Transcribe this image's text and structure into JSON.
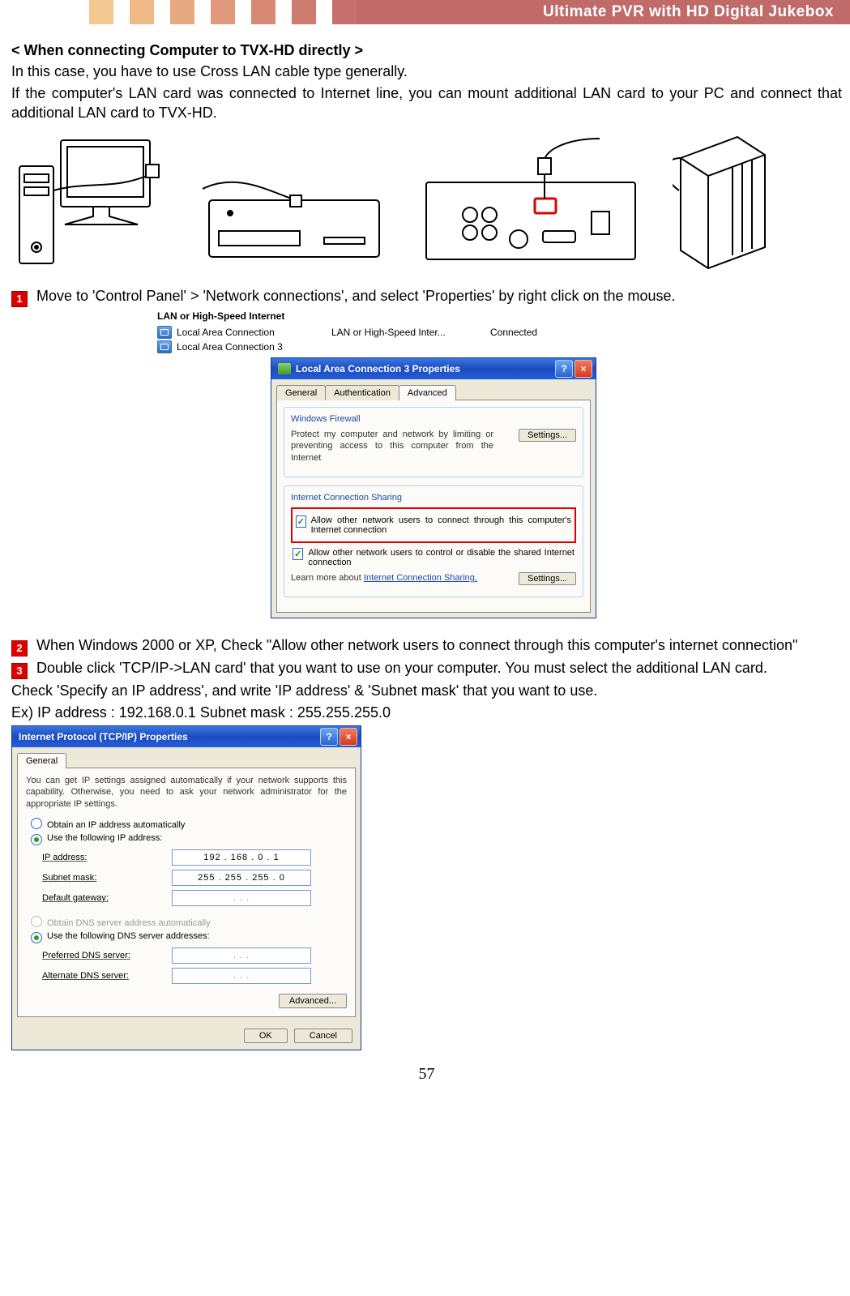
{
  "header": {
    "tick_colors": [
      "#f2c993",
      "#efb986",
      "#e7a97f",
      "#e19a7b",
      "#d88974",
      "#cf7c70",
      "#c8706d"
    ],
    "title": "Ultimate PVR with HD Digital Jukebox"
  },
  "text": {
    "section_title": "< When connecting Computer to TVX-HD directly >",
    "p1": "In this case, you have to use Cross LAN cable type generally.",
    "p2": "If the computer's LAN card was connected to Internet line, you can mount additional LAN card to your PC and connect that additional LAN card to TVX-HD.",
    "step1": "Move to 'Control Panel' > 'Network connections', and select 'Properties' by right click on the mouse.",
    "step2": "When Windows 2000 or XP, Check \"Allow other network users to connect through this computer's internet connection\"",
    "step3": "Double click 'TCP/IP->LAN card' that you want to use on your computer. You must select the additional LAN card.",
    "check_line": "Check 'Specify an IP address', and write 'IP address' & 'Subnet mask' that you want to use.",
    "example": "Ex)    IP address : 192.168.0.1      Subnet mask : 255.255.255.0"
  },
  "lan_panel": {
    "header": "LAN or High-Speed Internet",
    "rows": [
      {
        "name": "Local Area Connection",
        "type": "LAN or High-Speed Inter...",
        "status": "Connected"
      },
      {
        "name": "Local Area Connection 3",
        "type": "",
        "status": ""
      }
    ]
  },
  "lac_dialog": {
    "title": "Local Area Connection 3 Properties",
    "tabs": [
      "General",
      "Authentication",
      "Advanced"
    ],
    "active_tab": 2,
    "firewall": {
      "legend": "Windows Firewall",
      "desc": "Protect my computer and network by limiting or preventing access to this computer from the Internet",
      "button": "Settings..."
    },
    "ics": {
      "legend": "Internet Connection Sharing",
      "opt1": "Allow other network users to connect through this computer's Internet connection",
      "opt2": "Allow other network users to control or disable the shared Internet connection",
      "learn_prefix": "Learn more about ",
      "learn_link": "Internet Connection Sharing.",
      "button": "Settings..."
    }
  },
  "ip_dialog": {
    "title": "Internet Protocol (TCP/IP) Properties",
    "tab": "General",
    "desc": "You can get IP settings assigned automatically if your network supports this capability. Otherwise, you need to ask your network administrator for the appropriate IP settings.",
    "radio_auto_ip": "Obtain an IP address automatically",
    "radio_use_ip": "Use the following IP address:",
    "ip_label": "IP address:",
    "ip_value": "192 . 168 .   0   .   1",
    "subnet_label": "Subnet mask:",
    "subnet_value": "255 . 255 . 255 .   0",
    "gateway_label": "Default gateway:",
    "gateway_value": ".       .       .",
    "radio_auto_dns": "Obtain DNS server address automatically",
    "radio_use_dns": "Use the following DNS server addresses:",
    "pref_dns_label": "Preferred DNS server:",
    "alt_dns_label": "Alternate DNS server:",
    "dns_value": ".       .       .",
    "advanced": "Advanced...",
    "ok": "OK",
    "cancel": "Cancel"
  },
  "badges": {
    "n1": "1",
    "n2": "2",
    "n3": "3"
  },
  "page_number": "57"
}
